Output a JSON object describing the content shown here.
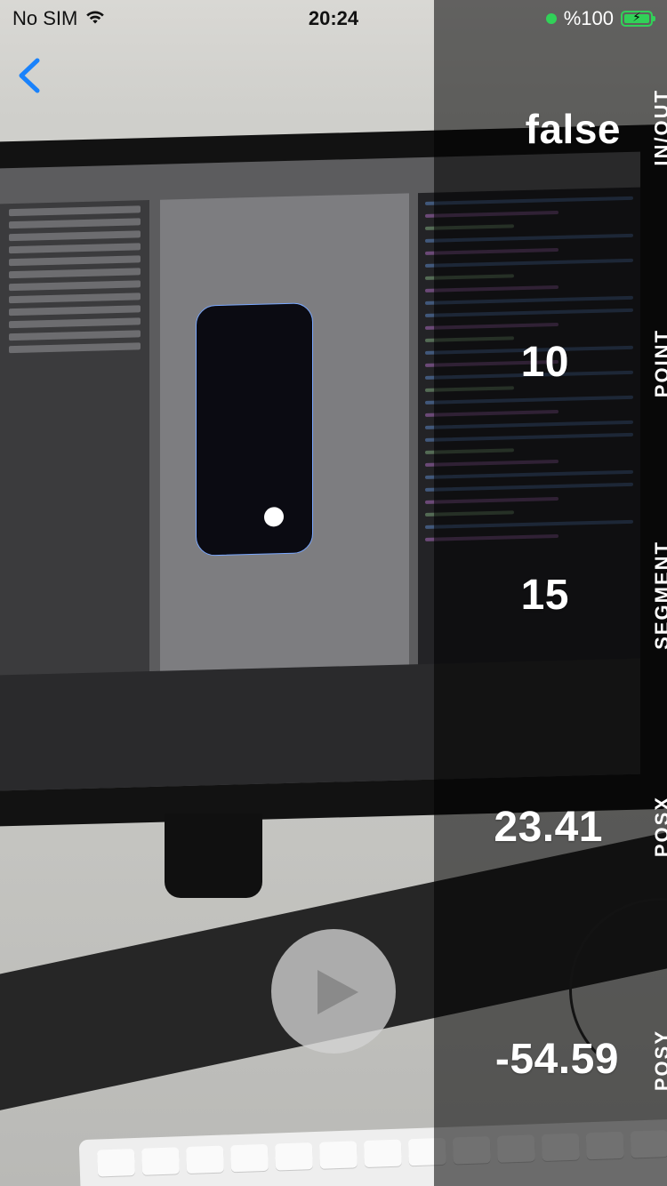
{
  "status_bar": {
    "carrier": "No SIM",
    "time": "20:24",
    "battery": "%100",
    "battery_level": 1.0,
    "icons": [
      "wifi-icon",
      "recording-dot-icon",
      "battery-charging-icon"
    ]
  },
  "navigation": {
    "back_icon": "chevron-left-icon",
    "accent_color": "#1a82fb"
  },
  "metrics": [
    {
      "label": "IN/OUT",
      "value": "false"
    },
    {
      "label": "POINT",
      "value": "10"
    },
    {
      "label": "SEGMENT",
      "value": "15"
    },
    {
      "label": "POSX",
      "value": "23.41"
    },
    {
      "label": "POSY",
      "value": "-54.59"
    }
  ],
  "player": {
    "play_icon": "play-icon"
  },
  "colors": {
    "panel_overlay": "rgba(0,0,0,0.55)",
    "status_green": "#31d158"
  }
}
